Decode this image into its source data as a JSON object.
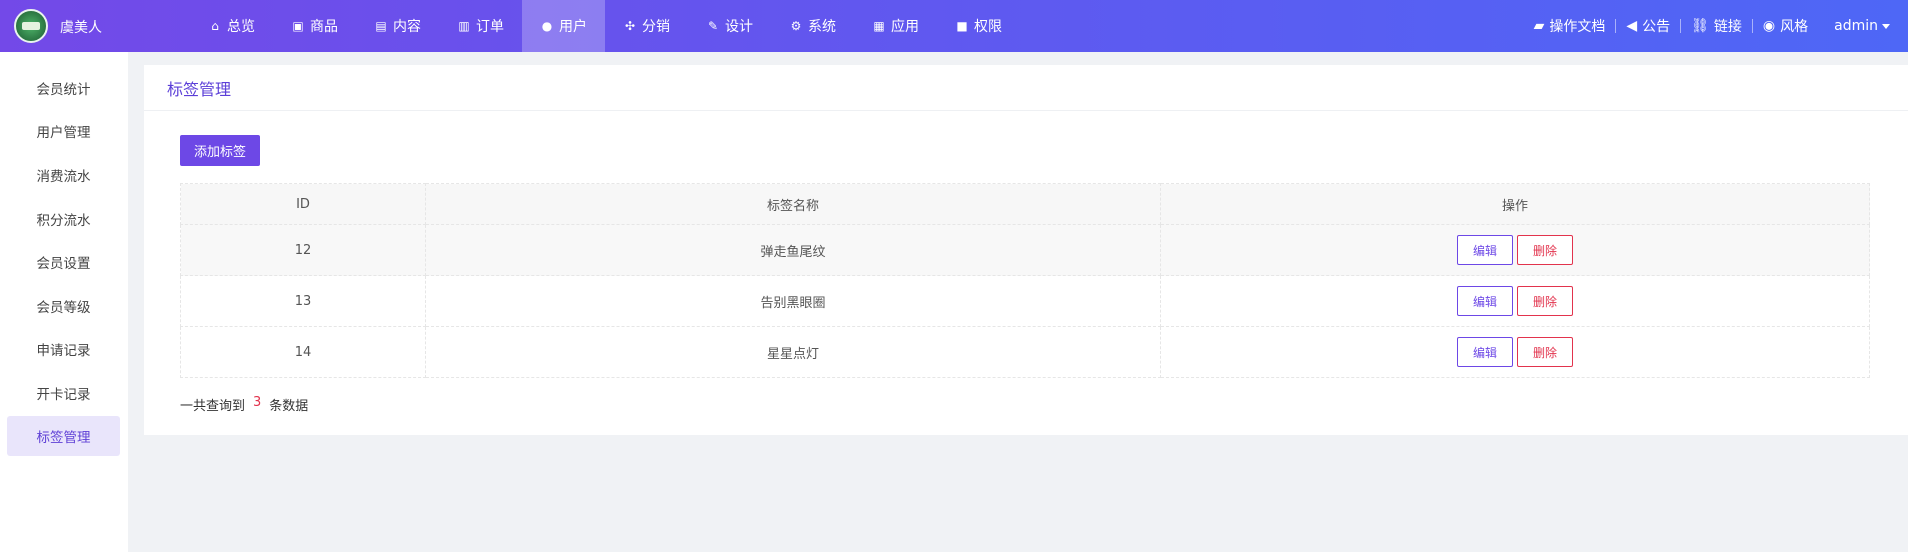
{
  "app": {
    "brand": "虞美人"
  },
  "nav": {
    "items": [
      {
        "label": "总览",
        "icon": "home-icon",
        "active": false
      },
      {
        "label": "商品",
        "icon": "shopping-bag-icon",
        "active": false
      },
      {
        "label": "内容",
        "icon": "document-icon",
        "active": false
      },
      {
        "label": "订单",
        "icon": "clipboard-icon",
        "active": false
      },
      {
        "label": "用户",
        "icon": "user-icon",
        "active": true
      },
      {
        "label": "分销",
        "icon": "network-icon",
        "active": false
      },
      {
        "label": "设计",
        "icon": "brush-icon",
        "active": false
      },
      {
        "label": "系统",
        "icon": "gear-icon",
        "active": false
      },
      {
        "label": "应用",
        "icon": "grid-icon",
        "active": false
      },
      {
        "label": "权限",
        "icon": "lock-icon",
        "active": false
      }
    ]
  },
  "header_right": {
    "docs": "操作文档",
    "notice": "公告",
    "link": "链接",
    "style": "风格",
    "user": "admin"
  },
  "sidebar": {
    "items": [
      {
        "label": "会员统计",
        "active": false
      },
      {
        "label": "用户管理",
        "active": false
      },
      {
        "label": "消费流水",
        "active": false
      },
      {
        "label": "积分流水",
        "active": false
      },
      {
        "label": "会员设置",
        "active": false
      },
      {
        "label": "会员等级",
        "active": false
      },
      {
        "label": "申请记录",
        "active": false
      },
      {
        "label": "开卡记录",
        "active": false
      },
      {
        "label": "标签管理",
        "active": true
      }
    ]
  },
  "main": {
    "title": "标签管理",
    "add_button": "添加标签",
    "table": {
      "headers": [
        "ID",
        "标签名称",
        "操作"
      ],
      "rows": [
        {
          "id": "12",
          "name": "弹走鱼尾纹"
        },
        {
          "id": "13",
          "name": "告别黑眼圈"
        },
        {
          "id": "14",
          "name": "星星点灯"
        }
      ],
      "edit_label": "编辑",
      "delete_label": "删除"
    },
    "summary": {
      "prefix": "一共查询到",
      "count": "3",
      "suffix": "条数据"
    }
  },
  "colors": {
    "accent": "#6d48e6",
    "danger": "#e2334d",
    "header_start": "#7349e8",
    "header_end": "#4e67f6"
  }
}
